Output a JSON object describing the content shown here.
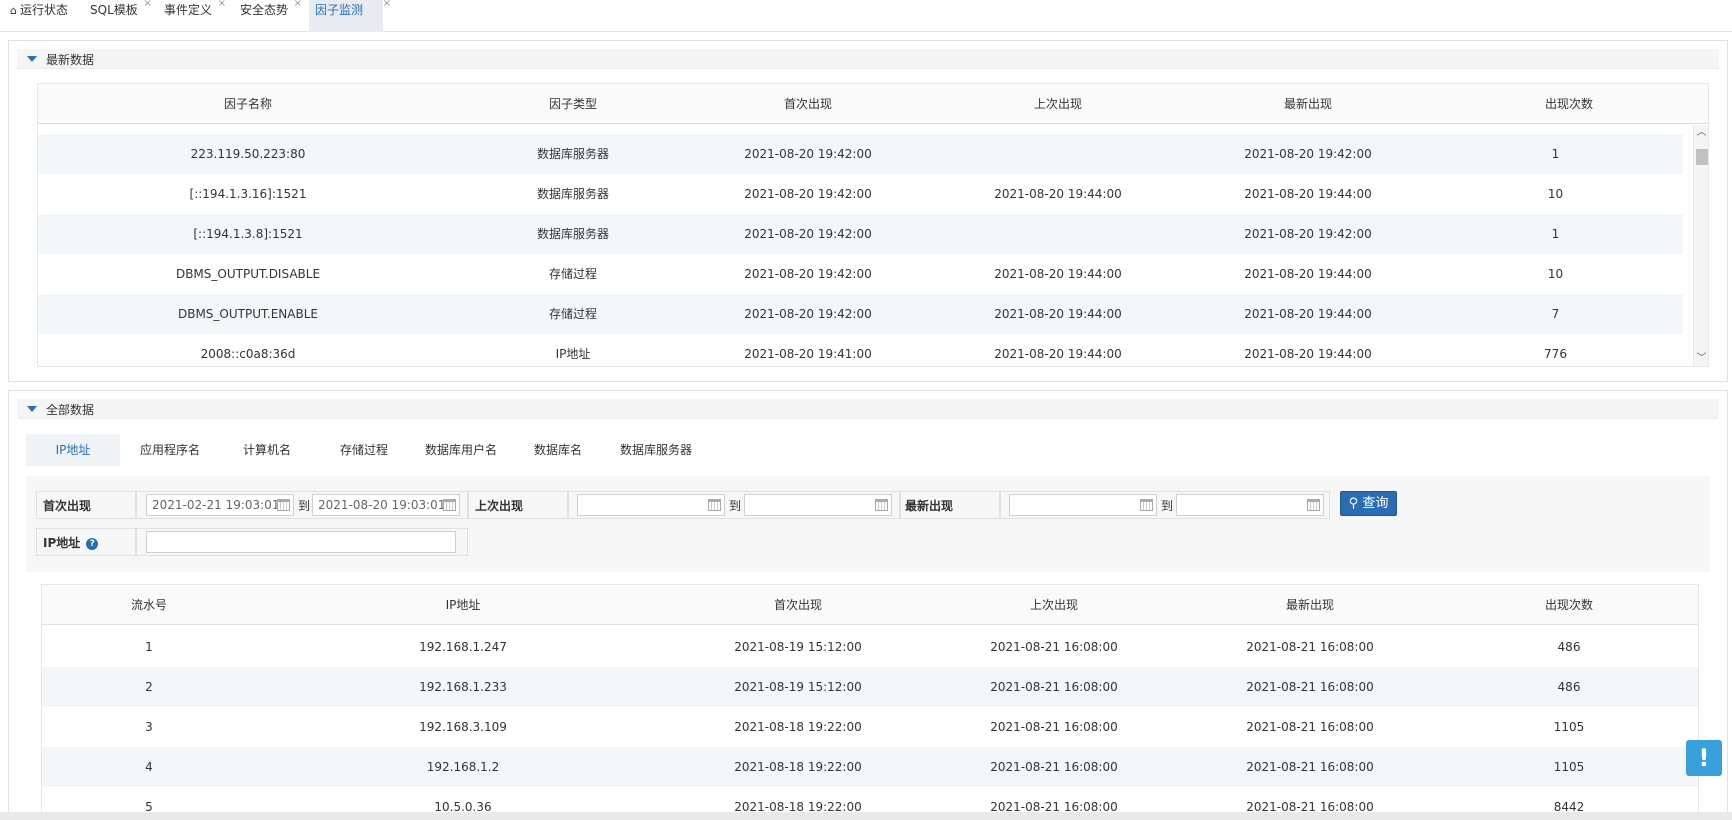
{
  "tabs": [
    {
      "label": "运行状态"
    },
    {
      "label": "SQL模板"
    },
    {
      "label": "事件定义"
    },
    {
      "label": "安全态势"
    },
    {
      "label": "因子监测"
    }
  ],
  "latest": {
    "title": "最新数据",
    "headers": [
      "因子名称",
      "因子类型",
      "首次出现",
      "上次出现",
      "最新出现",
      "出现次数"
    ],
    "rows": [
      [
        "223.119.50.223:80",
        "数据库服务器",
        "2021-08-20 19:42:00",
        "",
        "2021-08-20 19:42:00",
        "1"
      ],
      [
        "[::194.1.3.16]:1521",
        "数据库服务器",
        "2021-08-20 19:42:00",
        "2021-08-20 19:44:00",
        "2021-08-20 19:44:00",
        "10"
      ],
      [
        "[::194.1.3.8]:1521",
        "数据库服务器",
        "2021-08-20 19:42:00",
        "",
        "2021-08-20 19:42:00",
        "1"
      ],
      [
        "DBMS_OUTPUT.DISABLE",
        "存储过程",
        "2021-08-20 19:42:00",
        "2021-08-20 19:44:00",
        "2021-08-20 19:44:00",
        "10"
      ],
      [
        "DBMS_OUTPUT.ENABLE",
        "存储过程",
        "2021-08-20 19:42:00",
        "2021-08-20 19:44:00",
        "2021-08-20 19:44:00",
        "7"
      ],
      [
        "2008::c0a8:36d",
        "IP地址",
        "2021-08-20 19:41:00",
        "2021-08-20 19:44:00",
        "2021-08-20 19:44:00",
        "776"
      ]
    ]
  },
  "all": {
    "title": "全部数据",
    "subtabs": [
      "IP地址",
      "应用程序名",
      "计算机名",
      "存储过程",
      "数据库用户名",
      "数据库名",
      "数据库服务器"
    ],
    "filter": {
      "first_label": "首次出现",
      "first_from": "2021-02-21 19:03:01",
      "first_to": "2021-08-20 19:03:01",
      "last_label": "上次出现",
      "latest_label": "最新出现",
      "to": "到",
      "ip_label": "IP地址",
      "help_icon": "?",
      "query_label": "查询"
    },
    "headers": [
      "流水号",
      "IP地址",
      "首次出现",
      "上次出现",
      "最新出现",
      "出现次数"
    ],
    "rows": [
      [
        "1",
        "192.168.1.247",
        "2021-08-19 15:12:00",
        "2021-08-21 16:08:00",
        "2021-08-21 16:08:00",
        "486"
      ],
      [
        "2",
        "192.168.1.233",
        "2021-08-19 15:12:00",
        "2021-08-21 16:08:00",
        "2021-08-21 16:08:00",
        "486"
      ],
      [
        "3",
        "192.168.3.109",
        "2021-08-18 19:22:00",
        "2021-08-21 16:08:00",
        "2021-08-21 16:08:00",
        "1105"
      ],
      [
        "4",
        "192.168.1.2",
        "2021-08-18 19:22:00",
        "2021-08-21 16:08:00",
        "2021-08-21 16:08:00",
        "1105"
      ],
      [
        "5",
        "10.5.0.36",
        "2021-08-18 19:22:00",
        "2021-08-21 16:08:00",
        "2021-08-21 16:08:00",
        "8442"
      ]
    ]
  },
  "fab_label": "!",
  "colors": {
    "accent": "#2a6db0",
    "fab": "#3aa0dc",
    "row_alt": "#f4f7fa"
  }
}
